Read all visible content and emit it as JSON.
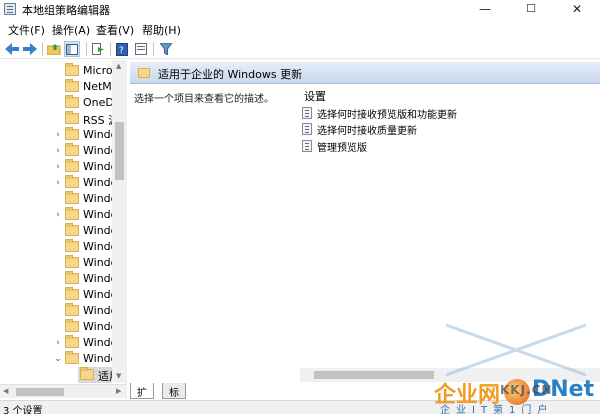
{
  "window": {
    "title": "本地组策略编辑器",
    "minimize_glyph": "—",
    "maximize_glyph": "☐",
    "close_glyph": "✕"
  },
  "menu": [
    {
      "label": "文件(F)"
    },
    {
      "label": "操作(A)"
    },
    {
      "label": "查看(V)"
    },
    {
      "label": "帮助(H)"
    }
  ],
  "toolbar": {
    "icons": [
      "back-icon",
      "forward-icon",
      "folder-up-icon",
      "show-hide-tree-icon",
      "export-list-icon",
      "help-icon",
      "properties-icon",
      "filter-icon"
    ]
  },
  "tree": {
    "items": [
      {
        "label": "Micro",
        "expandable": false
      },
      {
        "label": "NetMe",
        "expandable": false
      },
      {
        "label": "OneDr",
        "expandable": false
      },
      {
        "label": "RSS 源",
        "expandable": false
      },
      {
        "label": "Windo",
        "expandable": true
      },
      {
        "label": "Windo",
        "expandable": true
      },
      {
        "label": "Windo",
        "expandable": true
      },
      {
        "label": "Windo",
        "expandable": true
      },
      {
        "label": "Windo",
        "expandable": false
      },
      {
        "label": "Windo",
        "expandable": true
      },
      {
        "label": "Windo",
        "expandable": false
      },
      {
        "label": "Windo",
        "expandable": false
      },
      {
        "label": "Windo",
        "expandable": false
      },
      {
        "label": "Windo",
        "expandable": false
      },
      {
        "label": "Windo",
        "expandable": false
      },
      {
        "label": "Windo",
        "expandable": false
      },
      {
        "label": "Windo",
        "expandable": false
      },
      {
        "label": "Windo",
        "expandable": true
      },
      {
        "label": "Windo",
        "expandable": true,
        "expanded": true
      },
      {
        "label": "适用",
        "expandable": false,
        "selected": true
      }
    ]
  },
  "details": {
    "header_title": "适用于企业的 Windows 更新",
    "description_prompt": "选择一个项目来查看它的描述。",
    "column_header": "设置",
    "settings": [
      {
        "label": "选择何时接收预览版和功能更新"
      },
      {
        "label": "选择何时接收质量更新"
      },
      {
        "label": "管理预览版"
      }
    ]
  },
  "tabs": [
    {
      "label": "扩展",
      "active": true
    },
    {
      "label": "标准",
      "active": false
    }
  ],
  "status": {
    "text": "3 个设置"
  },
  "watermark": {
    "brand_left": "企业网",
    "brand_right": "DNet",
    "url": "KKJ.CN",
    "tagline": "企业IT第1门户"
  }
}
